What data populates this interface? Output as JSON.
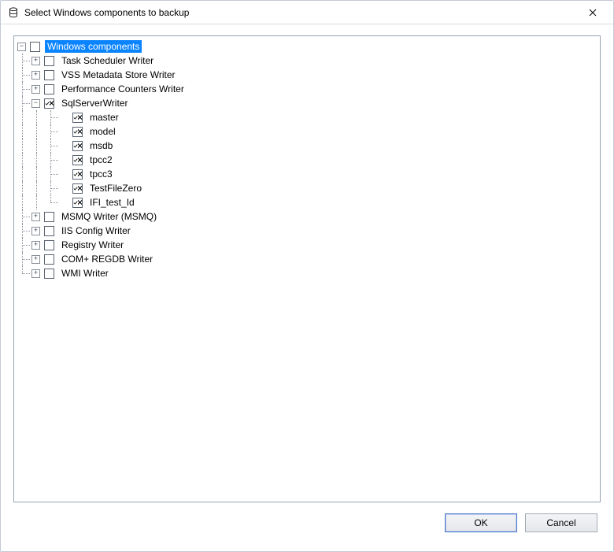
{
  "window": {
    "title": "Select Windows components to backup"
  },
  "tree": {
    "root": {
      "label": "Windows components",
      "expander": "minus",
      "checked": false,
      "selected": true,
      "children": [
        {
          "label": "Task Scheduler Writer",
          "expander": "plus",
          "checked": false
        },
        {
          "label": "VSS Metadata Store Writer",
          "expander": "plus",
          "checked": false
        },
        {
          "label": "Performance Counters Writer",
          "expander": "plus",
          "checked": false
        },
        {
          "label": "SqlServerWriter",
          "expander": "minus",
          "checked": true,
          "children": [
            {
              "label": "master",
              "checked": true
            },
            {
              "label": "model",
              "checked": true
            },
            {
              "label": "msdb",
              "checked": true
            },
            {
              "label": "tpcc2",
              "checked": true
            },
            {
              "label": "tpcc3",
              "checked": true
            },
            {
              "label": "TestFileZero",
              "checked": true
            },
            {
              "label": "IFI_test_Id",
              "checked": true
            }
          ]
        },
        {
          "label": "MSMQ Writer (MSMQ)",
          "expander": "plus",
          "checked": false
        },
        {
          "label": "IIS Config Writer",
          "expander": "plus",
          "checked": false
        },
        {
          "label": "Registry Writer",
          "expander": "plus",
          "checked": false
        },
        {
          "label": "COM+ REGDB Writer",
          "expander": "plus",
          "checked": false
        },
        {
          "label": "WMI Writer",
          "expander": "plus",
          "checked": false
        }
      ]
    }
  },
  "buttons": {
    "ok": "OK",
    "cancel": "Cancel"
  }
}
